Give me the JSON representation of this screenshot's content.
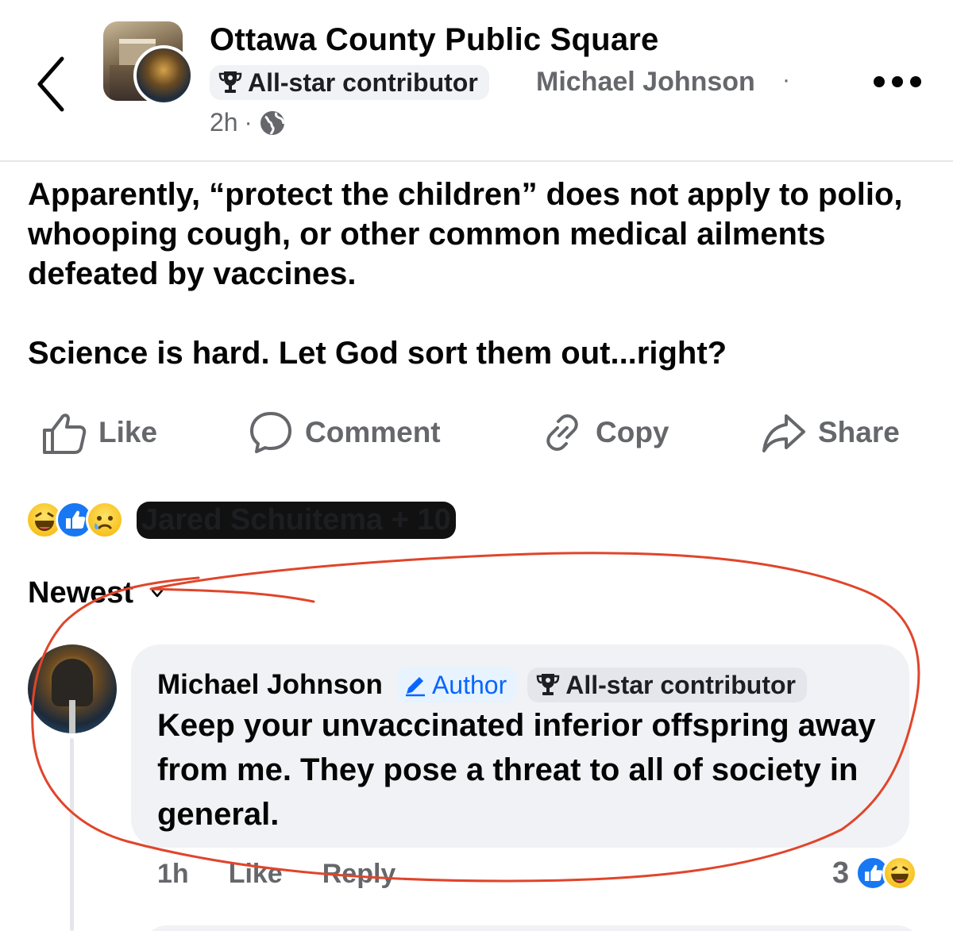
{
  "header": {
    "group_name": "Ottawa County Public Square",
    "contributor_badge": "All-star contributor",
    "author_name": "Michael Johnson",
    "author_sep": "·",
    "time": "2h",
    "time_sep": "·",
    "icons": {
      "back": "chevron-left-icon",
      "globe": "globe-icon",
      "more": "more-horizontal-icon",
      "trophy": "trophy-icon"
    }
  },
  "post": {
    "paragraph_1": "Apparently, “protect the children” does not apply to polio, whooping cough, or other common medical ailments defeated by vaccines.",
    "paragraph_2": "Science is hard.  Let God sort them out...right?"
  },
  "actions": {
    "like": "Like",
    "comment": "Comment",
    "copy": "Copy",
    "share": "Share"
  },
  "reactions": {
    "types": [
      "haha",
      "like",
      "sad"
    ],
    "reactors": "Jared Schuitema + 10"
  },
  "sort": {
    "label": "Newest"
  },
  "comment": {
    "author": "Michael Johnson",
    "author_badge": "Author",
    "contributor_badge": "All-star contributor",
    "text": "Keep your unvaccinated inferior offspring away from me.  They pose a threat to all of society in general.",
    "time": "1h",
    "like_label": "Like",
    "reply_label": "Reply",
    "reaction_count": "3",
    "reaction_types": [
      "like",
      "haha"
    ]
  },
  "colors": {
    "text_primary": "#050505",
    "text_secondary": "#65676b",
    "bubble_bg": "#f0f2f5",
    "badge_blue": "#0866ff",
    "like_blue": "#1877f2",
    "annotation_red": "#e0452b"
  }
}
